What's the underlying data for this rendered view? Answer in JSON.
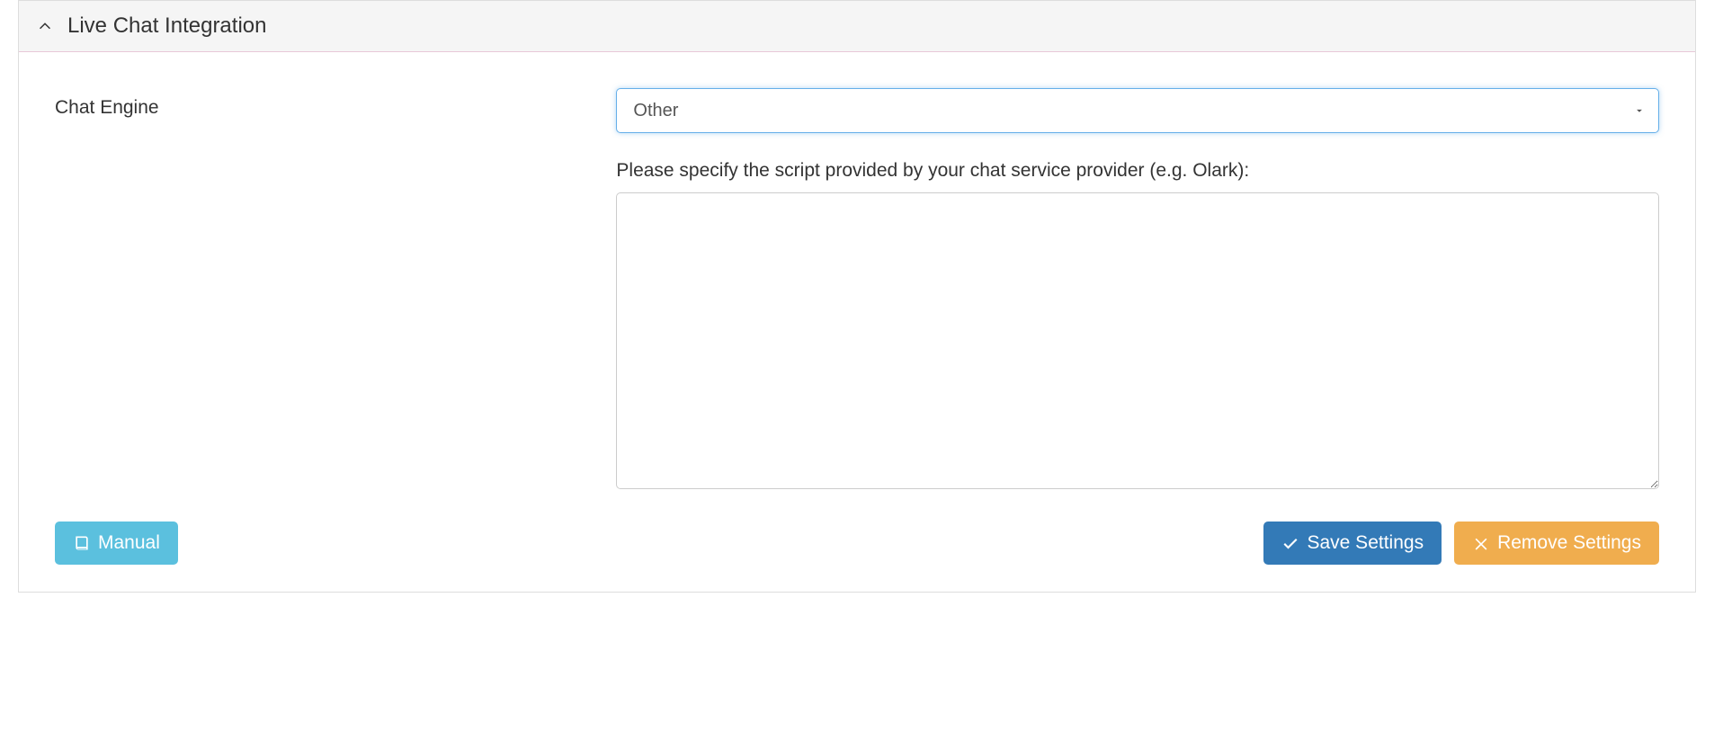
{
  "panel": {
    "title": "Live Chat Integration"
  },
  "form": {
    "chat_engine_label": "Chat Engine",
    "chat_engine_value": "Other",
    "script_label": "Please specify the script provided by your chat service provider (e.g. Olark):",
    "script_value": ""
  },
  "buttons": {
    "manual": "Manual",
    "save": "Save Settings",
    "remove": "Remove Settings"
  }
}
